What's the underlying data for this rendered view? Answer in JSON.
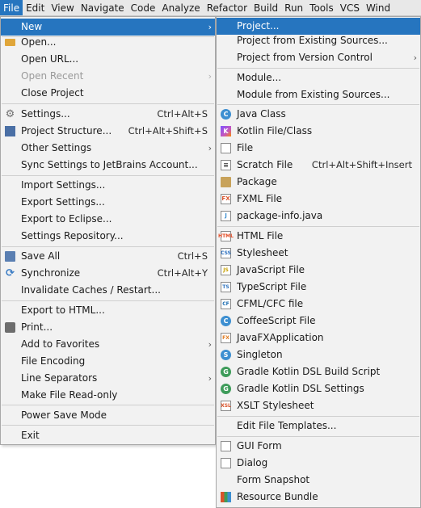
{
  "menubar": {
    "items": [
      {
        "label": "File"
      },
      {
        "label": "Edit"
      },
      {
        "label": "View"
      },
      {
        "label": "Navigate"
      },
      {
        "label": "Code"
      },
      {
        "label": "Analyze"
      },
      {
        "label": "Refactor"
      },
      {
        "label": "Build"
      },
      {
        "label": "Run"
      },
      {
        "label": "Tools"
      },
      {
        "label": "VCS"
      },
      {
        "label": "Wind"
      }
    ]
  },
  "file_menu": {
    "new": "New",
    "open": "Open...",
    "open_url": "Open URL...",
    "open_recent": "Open Recent",
    "close_project": "Close Project",
    "settings": "Settings...",
    "settings_sc": "Ctrl+Alt+S",
    "project_structure": "Project Structure...",
    "project_structure_sc": "Ctrl+Alt+Shift+S",
    "other_settings": "Other Settings",
    "sync_settings": "Sync Settings to JetBrains Account...",
    "import_settings": "Import Settings...",
    "export_settings": "Export Settings...",
    "export_eclipse": "Export to Eclipse...",
    "settings_repo": "Settings Repository...",
    "save_all": "Save All",
    "save_all_sc": "Ctrl+S",
    "synchronize": "Synchronize",
    "synchronize_sc": "Ctrl+Alt+Y",
    "invalidate": "Invalidate Caches / Restart...",
    "export_html": "Export to HTML...",
    "print": "Print...",
    "favorites": "Add to Favorites",
    "encoding": "File Encoding",
    "line_sep": "Line Separators",
    "read_only": "Make File Read-only",
    "power_save": "Power Save Mode",
    "exit": "Exit"
  },
  "new_menu": {
    "project": "Project...",
    "project_existing": "Project from Existing Sources...",
    "project_vcs": "Project from Version Control",
    "module": "Module...",
    "module_existing": "Module from Existing Sources...",
    "java_class": "Java Class",
    "kotlin_file": "Kotlin File/Class",
    "file": "File",
    "scratch_file": "Scratch File",
    "scratch_sc": "Ctrl+Alt+Shift+Insert",
    "package": "Package",
    "fxml_file": "FXML File",
    "package_info": "package-info.java",
    "html_file": "HTML File",
    "stylesheet": "Stylesheet",
    "js_file": "JavaScript File",
    "ts_file": "TypeScript File",
    "cfml_file": "CFML/CFC file",
    "coffee_file": "CoffeeScript File",
    "javafx_app": "JavaFXApplication",
    "singleton": "Singleton",
    "gradle_build": "Gradle Kotlin DSL Build Script",
    "gradle_settings": "Gradle Kotlin DSL Settings",
    "xslt": "XSLT Stylesheet",
    "edit_templates": "Edit File Templates...",
    "gui_form": "GUI Form",
    "dialog": "Dialog",
    "form_snapshot": "Form Snapshot",
    "resource_bundle": "Resource Bundle"
  },
  "glyphs": {
    "submenu_arrow": "›",
    "gear": "⚙",
    "sync": "⟳",
    "java": "C",
    "kotlin": "K",
    "coffee": "C",
    "singleton": "S",
    "gradle": "G",
    "fxml": "FX",
    "pkginfo": "J",
    "html": "HTML",
    "css": "CSS",
    "js": "JS",
    "ts": "TS",
    "cf": "CF",
    "jfx": "FX",
    "xslt": "XSL",
    "scratch": "≡"
  },
  "colors": {
    "highlight": "#2675bf",
    "menu_bg": "#f2f2f2",
    "disabled": "#9a9a9a"
  }
}
